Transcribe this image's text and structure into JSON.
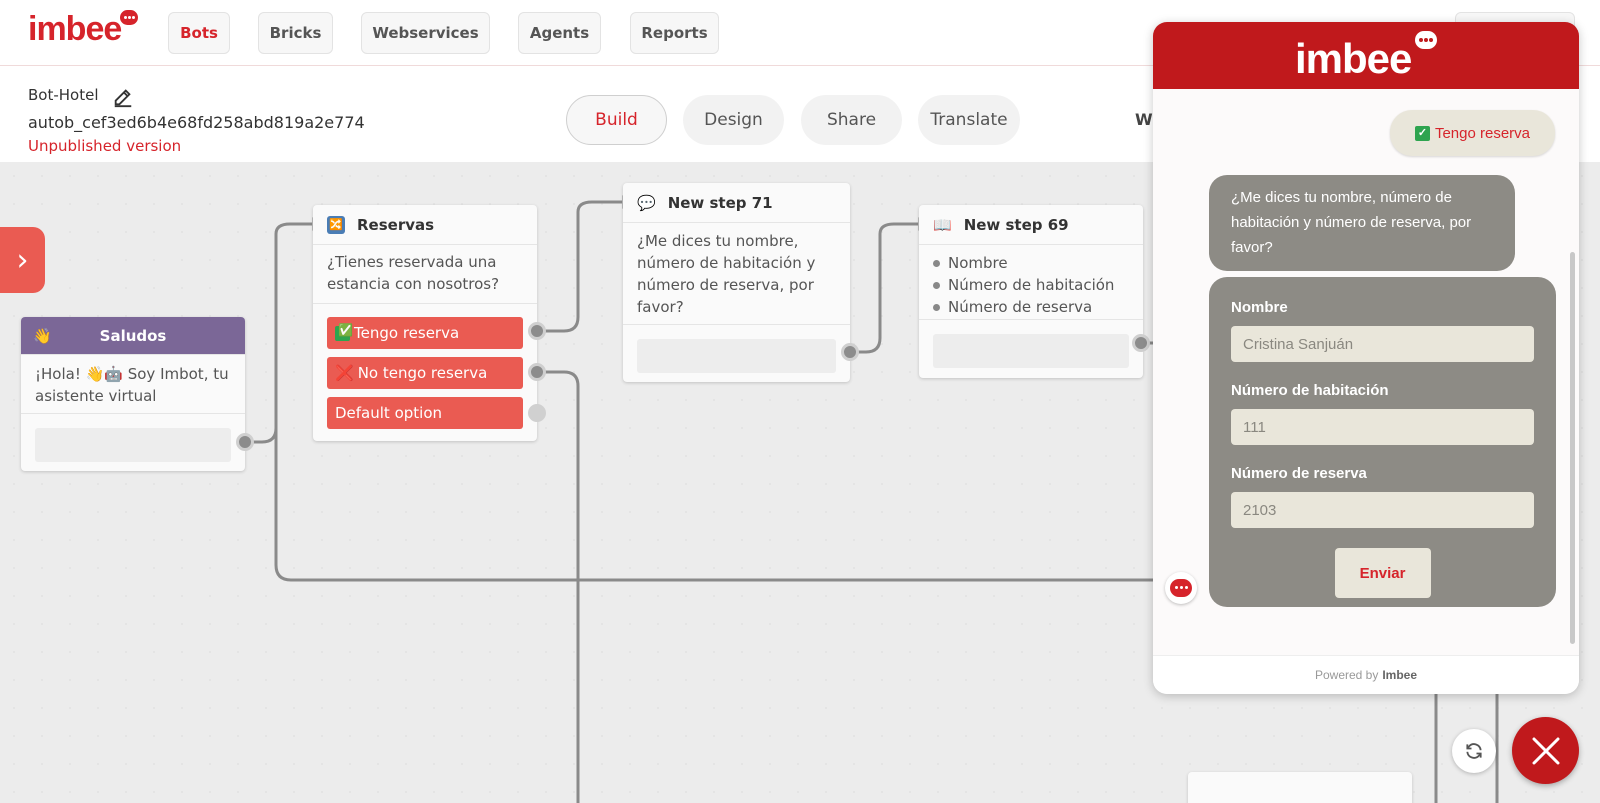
{
  "app": {
    "logo_text": "imbee"
  },
  "nav": {
    "items": [
      "Bots",
      "Bricks",
      "Webservices",
      "Agents",
      "Reports"
    ],
    "active": "Bots"
  },
  "bot": {
    "name": "Bot-Hotel",
    "id": "autob_cef3ed6b4e68fd258abd819a2e774",
    "status": "Unpublished version"
  },
  "mode_tabs": {
    "items": [
      "Build",
      "Design",
      "Share",
      "Translate"
    ],
    "active": "Build",
    "cut_label": "Wi"
  },
  "nodes": {
    "saludos": {
      "icon": "👋",
      "title": "Saludos",
      "text": "¡Hola! 👋🤖 Soy Imbot, tu asistente virtual"
    },
    "reservas": {
      "icon": "🔀",
      "title": "Reservas",
      "text": "¿Tienes reservada una estancia con nosotros?",
      "options": [
        {
          "mark": "✅",
          "label": "Tengo reserva"
        },
        {
          "mark": "❌",
          "label": "No tengo reserva"
        },
        {
          "mark": "",
          "label": "Default option"
        }
      ]
    },
    "step71": {
      "icon": "💬",
      "title": "New step 71",
      "text": "¿Me dices tu nombre, número de habitación y número de reserva, por favor?"
    },
    "step69": {
      "icon": "📖",
      "title": "New step 69",
      "items": [
        "Nombre",
        "Número de habitación",
        "Número de reserva"
      ]
    }
  },
  "chat": {
    "logo_text": "imbee",
    "user_message": "Tengo reserva",
    "bot_message": "¿Me dices tu nombre, número de habitación y número de reserva, por favor?",
    "form": {
      "fields": [
        {
          "label": "Nombre",
          "value": "Cristina Sanjuán"
        },
        {
          "label": "Número de habitación",
          "value": "111"
        },
        {
          "label": "Número de reserva",
          "value": "2103"
        }
      ],
      "submit_label": "Enviar"
    },
    "footer_prefix": "Powered by",
    "footer_brand": "Imbee"
  },
  "colors": {
    "brand_red": "#d6242b",
    "option_red": "#ea5b52",
    "chat_header": "#c0191c",
    "bubble_gray": "#8d8b85",
    "input_beige": "#e9e6da",
    "saludos_header": "#7b6797"
  }
}
